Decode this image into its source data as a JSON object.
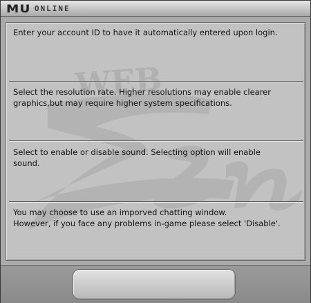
{
  "window": {
    "logo_mark": "MU",
    "logo_text": "ONLINE",
    "watermark": "WEB Zen"
  },
  "sections": [
    {
      "lines": [
        "Enter your account ID to have it automatically entered upon login."
      ]
    },
    {
      "lines": [
        "Select the resolution rate. Higher resolutions may enable clearer",
        "graphics,but may require higher system specifications."
      ]
    },
    {
      "lines": [
        "Select to enable or disable sound. Selecting option will enable",
        "sound."
      ]
    },
    {
      "lines": [
        "You may choose to use an imporved chatting window.",
        "However, if you face any problems in-game please select 'Disable'."
      ]
    }
  ],
  "colors": {
    "panel_bg": "#c2c2c2",
    "frame": "#aaaaaa",
    "text": "#111111"
  }
}
